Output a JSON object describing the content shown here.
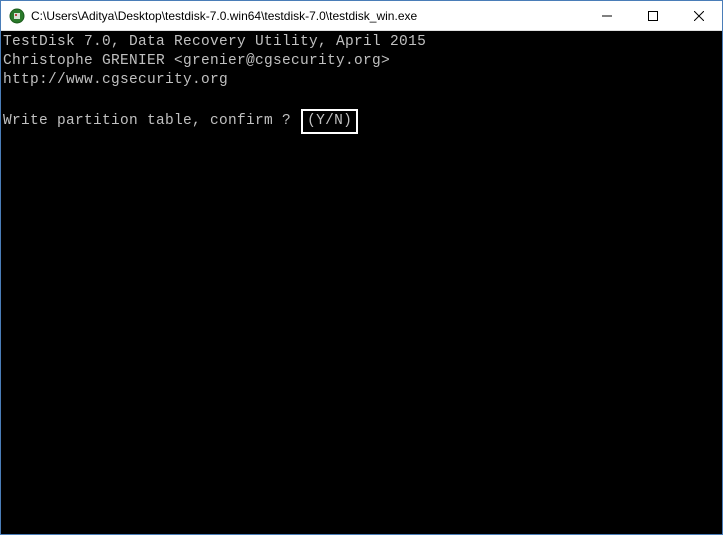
{
  "titlebar": {
    "title": "C:\\Users\\Aditya\\Desktop\\testdisk-7.0.win64\\testdisk-7.0\\testdisk_win.exe"
  },
  "console": {
    "line1": "TestDisk 7.0, Data Recovery Utility, April 2015",
    "line2": "Christophe GRENIER <grenier@cgsecurity.org>",
    "line3": "http://www.cgsecurity.org",
    "prompt_text": "Write partition table, confirm ?",
    "prompt_choice": "(Y/N)"
  }
}
